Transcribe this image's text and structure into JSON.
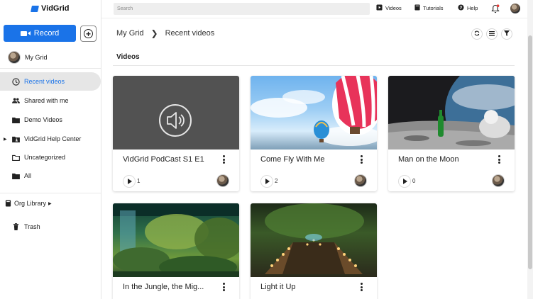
{
  "app": {
    "name": "VidGrid"
  },
  "sidebar": {
    "record_label": "Record",
    "user_label": "My Grid",
    "items": [
      {
        "label": "Recent videos",
        "icon": "clock-icon",
        "active": true
      },
      {
        "label": "Shared with me",
        "icon": "people-icon"
      },
      {
        "label": "Demo Videos",
        "icon": "folder-filled-icon"
      },
      {
        "label": "VidGrid Help Center",
        "icon": "folder-people-icon"
      },
      {
        "label": "Uncategorized",
        "icon": "folder-outline-icon"
      },
      {
        "label": "All",
        "icon": "folder-filled-icon"
      }
    ],
    "org_library_label": "Org Library",
    "trash_label": "Trash"
  },
  "topbar": {
    "search_placeholder": "Search",
    "links": [
      {
        "label": "Videos",
        "icon": "video-icon"
      },
      {
        "label": "Tutorials",
        "icon": "book-icon"
      },
      {
        "label": "Help",
        "icon": "help-icon"
      }
    ]
  },
  "main": {
    "breadcrumb": [
      "My Grid",
      "Recent videos"
    ],
    "section_title": "Videos",
    "videos": [
      {
        "title": "VidGrid PodCast S1 E1",
        "views": "1",
        "thumb": "audio"
      },
      {
        "title": "Come Fly With Me",
        "views": "2",
        "thumb": "balloon"
      },
      {
        "title": "Man on the Moon",
        "views": "0",
        "thumb": "moon"
      },
      {
        "title": "In the Jungle, the Mig...",
        "views": "",
        "thumb": "jungle"
      },
      {
        "title": "Light it Up",
        "views": "",
        "thumb": "lights"
      }
    ]
  },
  "colors": {
    "accent": "#1a73e8",
    "active_bg": "#e6e6e6"
  }
}
